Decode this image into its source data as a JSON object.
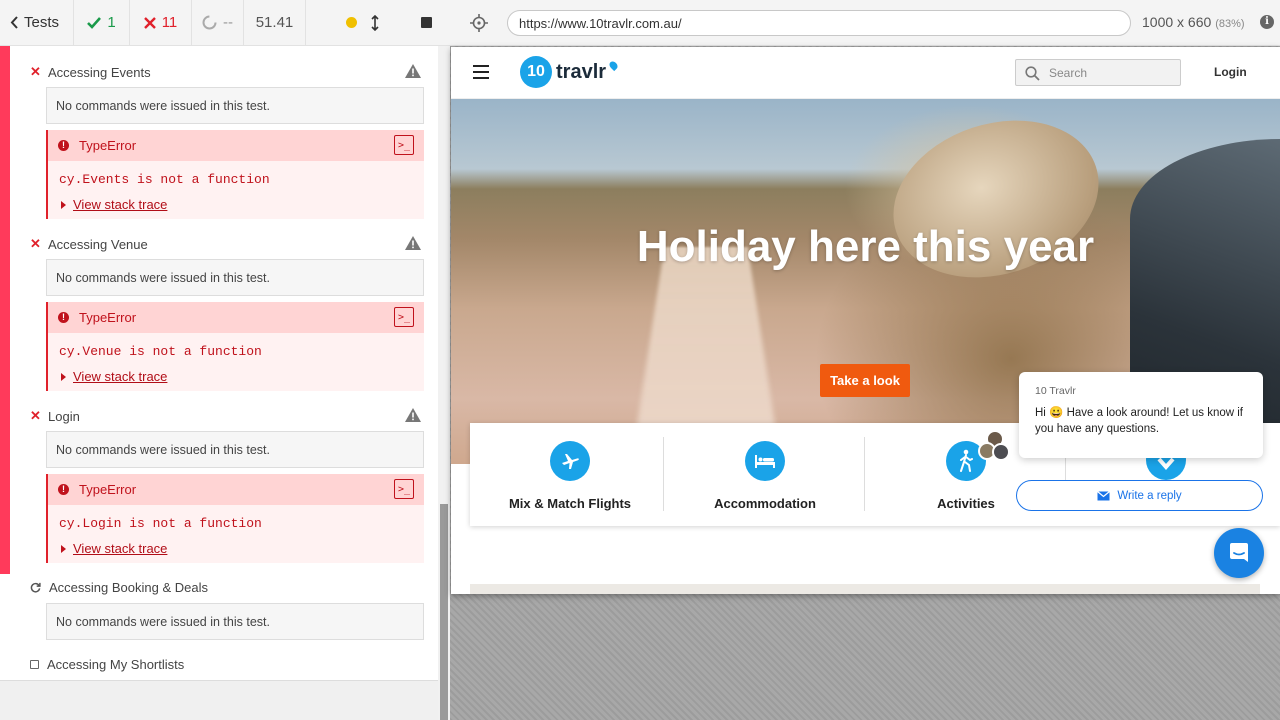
{
  "reporter": {
    "tests_label": "Tests",
    "passed": "1",
    "failed": "11",
    "pending": "--",
    "duration": "51.41"
  },
  "tests": [
    {
      "title": "Accessing Events",
      "no_commands": "No commands were issued in this test.",
      "error_type": "TypeError",
      "error_message": "cy.Events is not a function",
      "stack_link": "View stack trace"
    },
    {
      "title": "Accessing Venue",
      "no_commands": "No commands were issued in this test.",
      "error_type": "TypeError",
      "error_message": "cy.Venue is not a function",
      "stack_link": "View stack trace"
    },
    {
      "title": "Login",
      "no_commands": "No commands were issued in this test.",
      "error_type": "TypeError",
      "error_message": "cy.Login is not a function",
      "stack_link": "View stack trace"
    },
    {
      "title": "Accessing Booking & Deals",
      "no_commands": "No commands were issued in this test."
    },
    {
      "title": "Accessing My Shortlists"
    }
  ],
  "aut": {
    "url": "https://www.10travlr.com.au/",
    "viewport": "1000 x 660",
    "zoom": "(83%)"
  },
  "site": {
    "logo_number": "10",
    "logo_text": "travlr",
    "search_placeholder": "Search",
    "login": "Login",
    "hero_title": "Holiday here this year",
    "cta": "Take a look",
    "cards": [
      {
        "label": "Mix & Match Flights",
        "icon": "plane-icon"
      },
      {
        "label": "Accommodation",
        "icon": "bed-icon"
      },
      {
        "label": "Activities",
        "icon": "hiking-icon"
      }
    ]
  },
  "chat": {
    "from": "10 Travlr",
    "message": "Hi 😀 Have a look around! Let us know if you have any questions.",
    "reply": "Write a reply"
  },
  "colors": {
    "fail_red": "#e0212b",
    "pass_green": "#1a9a4a",
    "brand_blue": "#1aa3e8",
    "cta_orange": "#f05a0f"
  }
}
